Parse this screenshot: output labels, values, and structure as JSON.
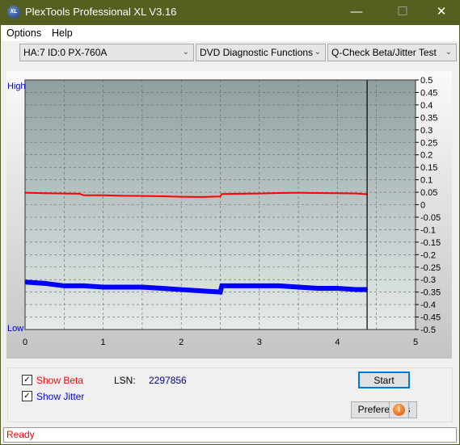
{
  "window": {
    "title": "PlexTools Professional XL V3.16",
    "logo_text": "XL"
  },
  "menu": {
    "options": "Options",
    "help": "Help"
  },
  "toolbar": {
    "drive": "HA:7 ID:0  PX-760A",
    "function_group": "DVD Diagnostic Functions",
    "test": "Q-Check Beta/Jitter Test"
  },
  "chart_data": {
    "type": "line",
    "xlim": [
      0,
      5
    ],
    "ylim": [
      -0.5,
      0.5
    ],
    "x_ticks": [
      "0",
      "1",
      "2",
      "3",
      "4",
      "5"
    ],
    "y_ticks": [
      "0.5",
      "0.45",
      "0.4",
      "0.35",
      "0.3",
      "0.25",
      "0.2",
      "0.15",
      "0.1",
      "0.05",
      "0",
      "-0.05",
      "-0.1",
      "-0.15",
      "-0.2",
      "-0.25",
      "-0.3",
      "-0.35",
      "-0.4",
      "-0.45",
      "-0.5"
    ],
    "left_labels": {
      "high": "High",
      "low": "Low"
    },
    "grid": true,
    "end_marker_x": 4.38,
    "colors": {
      "beta": "#ff0000",
      "jitter": "#0000ff",
      "marker": "#000000"
    },
    "x": [
      0,
      0.25,
      0.5,
      0.7,
      0.75,
      1.0,
      1.25,
      1.5,
      1.75,
      2.0,
      2.25,
      2.5,
      2.52,
      2.75,
      3.0,
      3.25,
      3.5,
      3.75,
      4.0,
      4.25,
      4.38
    ],
    "series": [
      {
        "key": "beta",
        "values": [
          0.048,
          0.046,
          0.045,
          0.044,
          0.038,
          0.038,
          0.036,
          0.035,
          0.034,
          0.032,
          0.031,
          0.033,
          0.043,
          0.044,
          0.045,
          0.047,
          0.048,
          0.047,
          0.046,
          0.045,
          0.042
        ]
      },
      {
        "key": "jitter",
        "values": [
          -0.31,
          -0.315,
          -0.325,
          -0.325,
          -0.325,
          -0.33,
          -0.33,
          -0.33,
          -0.335,
          -0.34,
          -0.345,
          -0.35,
          -0.325,
          -0.325,
          -0.325,
          -0.325,
          -0.33,
          -0.335,
          -0.335,
          -0.34,
          -0.34
        ]
      }
    ]
  },
  "controls": {
    "show_beta": "Show Beta",
    "show_jitter": "Show Jitter",
    "lsn_label": "LSN:",
    "lsn_value": "2297856",
    "start": "Start",
    "preferences": "Preferences",
    "info_icon": "i"
  },
  "status": "Ready"
}
